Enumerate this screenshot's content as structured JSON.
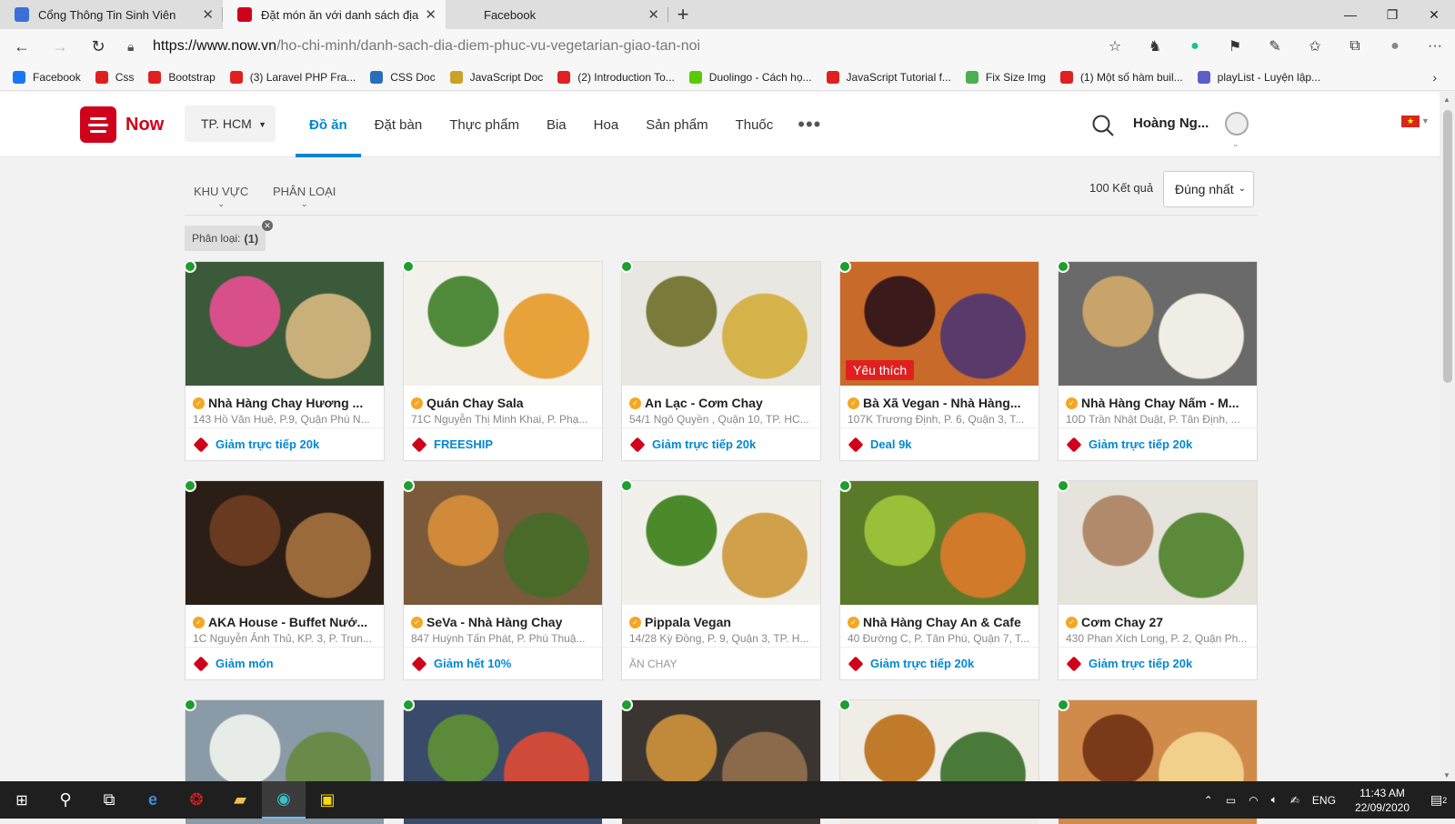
{
  "browser": {
    "tabs": [
      {
        "title": "Cổng Thông Tin Sinh Viên",
        "icon": "university-icon",
        "color": "#3a6fd8"
      },
      {
        "title": "Đặt món ăn với danh sách địa điểm",
        "icon": "now-icon",
        "color": "#d0021b"
      },
      {
        "title": "Facebook",
        "icon": "",
        "color": ""
      }
    ],
    "url_host": "https://www.now.vn",
    "url_path": "/ho-chi-minh/danh-sach-dia-diem-phuc-vu-vegetarian-giao-tan-noi",
    "bookmarks": [
      {
        "label": "Facebook",
        "color": "#1877f2"
      },
      {
        "label": "Css",
        "color": "#e02020"
      },
      {
        "label": "Bootstrap",
        "color": "#e02020"
      },
      {
        "label": "(3) Laravel PHP Fra...",
        "color": "#e02020"
      },
      {
        "label": "CSS Doc",
        "color": "#2a6ebb"
      },
      {
        "label": "JavaScript Doc",
        "color": "#c9a227"
      },
      {
        "label": "(2) Introduction To...",
        "color": "#e02020"
      },
      {
        "label": "Duolingo - Cách họ...",
        "color": "#58cc02"
      },
      {
        "label": "JavaScript Tutorial f...",
        "color": "#e02020"
      },
      {
        "label": "Fix Size Img",
        "color": "#4caf50"
      },
      {
        "label": "(1) Một số hàm buil...",
        "color": "#e02020"
      },
      {
        "label": "playList - Luyện lập...",
        "color": "#5b5fc7"
      }
    ]
  },
  "site": {
    "logo_text": "Now",
    "city": "TP. HCM",
    "menu": [
      "Đồ ăn",
      "Đặt bàn",
      "Thực phẩm",
      "Bia",
      "Hoa",
      "Sản phẩm",
      "Thuốc"
    ],
    "menu_active_index": 0,
    "user_name": "Hoàng Ng...",
    "accent": "#0288d1",
    "brand": "#d0021b"
  },
  "filters": {
    "area_label": "KHU VỰC",
    "category_label": "PHÂN LOẠI",
    "result_count": "100 Kết quả",
    "sort_value": "Đúng nhất",
    "chip_label": "Phân loại:",
    "chip_value": "(1)"
  },
  "restaurants": [
    {
      "name": "Nhà Hàng Chay Hương ...",
      "address": "143 Hồ Văn Huê, P.9, Quận Phú N...",
      "promo": "Giảm trực tiếp 20k",
      "promo_type": "tag",
      "badge": "",
      "img": [
        "#3b5a3a",
        "#d94f8a",
        "#c9b07a"
      ]
    },
    {
      "name": "Quán Chay Sala",
      "address": "71C Nguyễn Thị Minh Khai, P. Phạ...",
      "promo": "FREESHIP",
      "promo_type": "tag",
      "badge": "",
      "img": [
        "#f3f1ec",
        "#4f8a3a",
        "#e8a23a"
      ]
    },
    {
      "name": "An Lạc - Cơm Chay",
      "address": "54/1 Ngô Quyền , Quận 10, TP. HC...",
      "promo": "Giảm trực tiếp 20k",
      "promo_type": "tag",
      "badge": "",
      "img": [
        "#e9e7e2",
        "#7a7a3a",
        "#d6b24a"
      ]
    },
    {
      "name": "Bà Xã Vegan - Nhà Hàng...",
      "address": "107K Trương Định, P. 6, Quận 3, T...",
      "promo": "Deal 9k",
      "promo_type": "tag",
      "badge": "Yêu thích",
      "img": [
        "#c86a2a",
        "#3a1a1a",
        "#5a3a6a"
      ]
    },
    {
      "name": "Nhà Hàng Chay Nấm - M...",
      "address": "10D Trần Nhật Duật, P. Tân Định, ...",
      "promo": "Giảm trực tiếp 20k",
      "promo_type": "tag",
      "badge": "",
      "img": [
        "#6a6a6a",
        "#c9a46a",
        "#f0ede6"
      ]
    },
    {
      "name": "AKA House - Buffet Nướ...",
      "address": "1C Nguyễn Ảnh Thủ, KP. 3, P. Trun...",
      "promo": "Giảm món",
      "promo_type": "tag",
      "badge": "",
      "img": [
        "#2a1e16",
        "#6a3a20",
        "#9a6a3a"
      ]
    },
    {
      "name": "SeVa - Nhà Hàng Chay",
      "address": "847 Huỳnh Tấn Phát, P. Phú Thuậ...",
      "promo": "Giảm hết 10%",
      "promo_type": "tag",
      "badge": "",
      "img": [
        "#7a5a3a",
        "#d08a3a",
        "#4a6a2a"
      ]
    },
    {
      "name": "Pippala Vegan",
      "address": "14/28 Kỳ Đồng, P. 9, Quận 3, TP. H...",
      "promo": "ĂN CHAY",
      "promo_type": "plain",
      "badge": "",
      "img": [
        "#f2f0ea",
        "#4a8a2a",
        "#d0a04a"
      ]
    },
    {
      "name": "Nhà Hàng Chay An & Cafe",
      "address": "40 Đường C, P. Tân Phú, Quận 7, T...",
      "promo": "Giảm trực tiếp 20k",
      "promo_type": "tag",
      "badge": "",
      "img": [
        "#5a7a2a",
        "#9ac03a",
        "#d07a2a"
      ]
    },
    {
      "name": "Cơm Chay 27",
      "address": "430 Phan Xích Long, P. 2, Quận Ph...",
      "promo": "Giảm trực tiếp 20k",
      "promo_type": "tag",
      "badge": "",
      "img": [
        "#e6e2dc",
        "#b08a6a",
        "#5a8a3a"
      ]
    },
    {
      "name": "",
      "address": "",
      "promo": "",
      "promo_type": "none",
      "badge": "",
      "img": [
        "#8a9aa6",
        "#e8ece6",
        "#6a8a4a"
      ]
    },
    {
      "name": "",
      "address": "",
      "promo": "",
      "promo_type": "none",
      "badge": "",
      "img": [
        "#3a4a6a",
        "#5a8a3a",
        "#d04a3a"
      ]
    },
    {
      "name": "",
      "address": "",
      "promo": "",
      "promo_type": "none",
      "badge": "",
      "img": [
        "#3a3530",
        "#c08a3a",
        "#8a6a4a"
      ]
    },
    {
      "name": "",
      "address": "",
      "promo": "",
      "promo_type": "none",
      "badge": "",
      "img": [
        "#f0ece6",
        "#c07a2a",
        "#4a7a3a"
      ]
    },
    {
      "name": "",
      "address": "",
      "promo": "",
      "promo_type": "none",
      "badge": "",
      "img": [
        "#d08a4a",
        "#7a3a1a",
        "#f0d08a"
      ]
    }
  ],
  "taskbar": {
    "lang": "ENG",
    "time": "11:43 AM",
    "date": "22/09/2020",
    "notif_count": "2"
  }
}
